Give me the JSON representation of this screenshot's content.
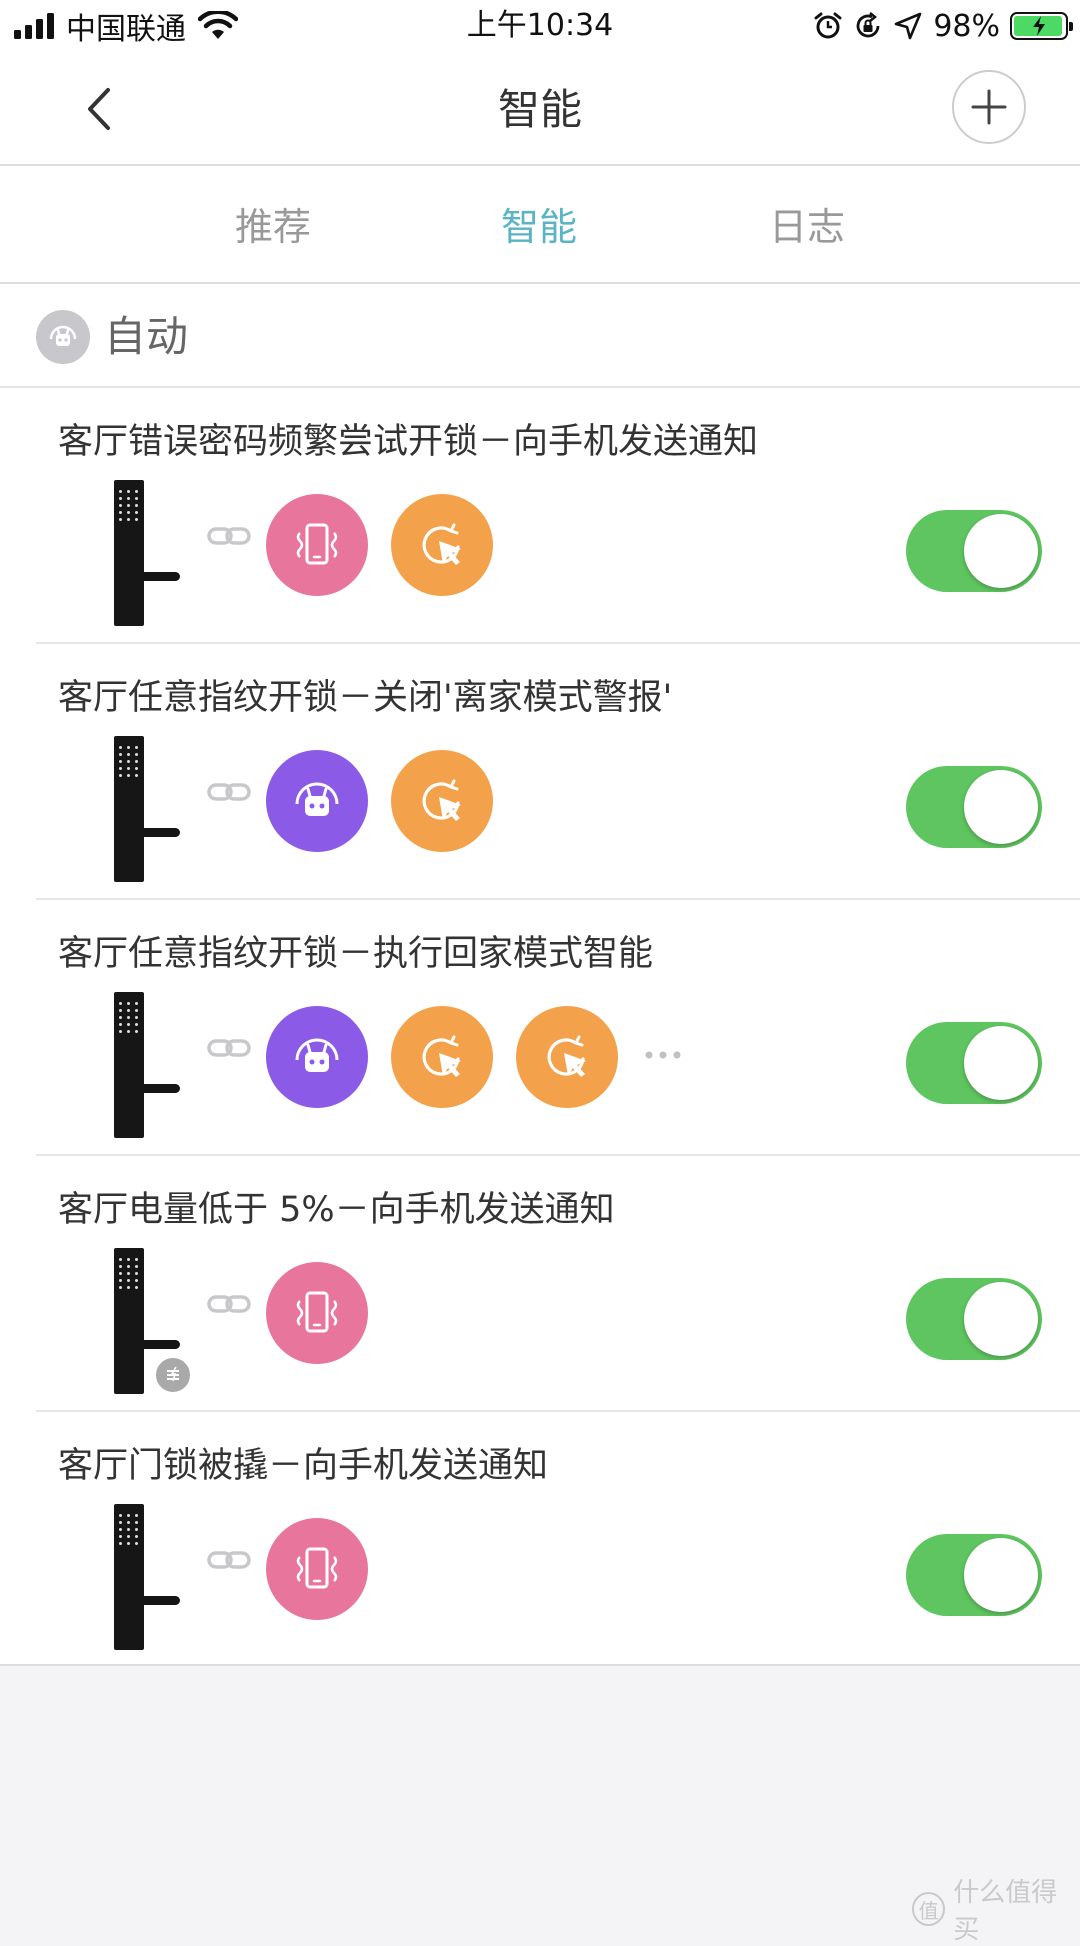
{
  "status_bar": {
    "carrier": "中国联通",
    "time": "上午10:34",
    "battery_percent": "98%",
    "battery_level": 0.98,
    "icons": [
      "signal-icon",
      "wifi-icon",
      "alarm-icon",
      "rotation-lock-icon",
      "location-icon",
      "battery-charging-icon"
    ]
  },
  "nav": {
    "title": "智能",
    "back_icon": "chevron-left-icon",
    "add_icon": "plus-icon"
  },
  "tabs": [
    {
      "label": "推荐",
      "active": false
    },
    {
      "label": "智能",
      "active": true
    },
    {
      "label": "日志",
      "active": false
    }
  ],
  "section": {
    "label": "自动",
    "icon": "robot-icon"
  },
  "rules": [
    {
      "title": "客厅错误密码频繁尝试开锁－向手机发送通知",
      "actions": [
        "phone-notify",
        "scene"
      ],
      "more": false,
      "battery_badge": false,
      "enabled": true
    },
    {
      "title": "客厅任意指纹开锁－关闭'离家模式警报'",
      "actions": [
        "robot",
        "scene"
      ],
      "more": false,
      "battery_badge": false,
      "enabled": true
    },
    {
      "title": "客厅任意指纹开锁－执行回家模式智能",
      "actions": [
        "robot",
        "scene",
        "scene"
      ],
      "more": true,
      "battery_badge": false,
      "enabled": true
    },
    {
      "title": "客厅电量低于 5%－向手机发送通知",
      "actions": [
        "phone-notify"
      ],
      "more": false,
      "battery_badge": true,
      "enabled": true
    },
    {
      "title": "客厅门锁被撬－向手机发送通知",
      "actions": [
        "phone-notify"
      ],
      "more": false,
      "battery_badge": false,
      "enabled": true
    }
  ],
  "action_types": {
    "phone-notify": {
      "icon": "phone-vibrate-icon",
      "color": "#e8759c"
    },
    "scene": {
      "icon": "cursor-click-icon",
      "color": "#f3a24b"
    },
    "robot": {
      "icon": "robot-icon",
      "color": "#8b5ae6"
    }
  },
  "colors": {
    "accent": "#5ab4c5",
    "toggle_on": "#5fc560",
    "tab_inactive": "#999999"
  },
  "watermark": {
    "text": "什么值得买",
    "badge": "值"
  }
}
